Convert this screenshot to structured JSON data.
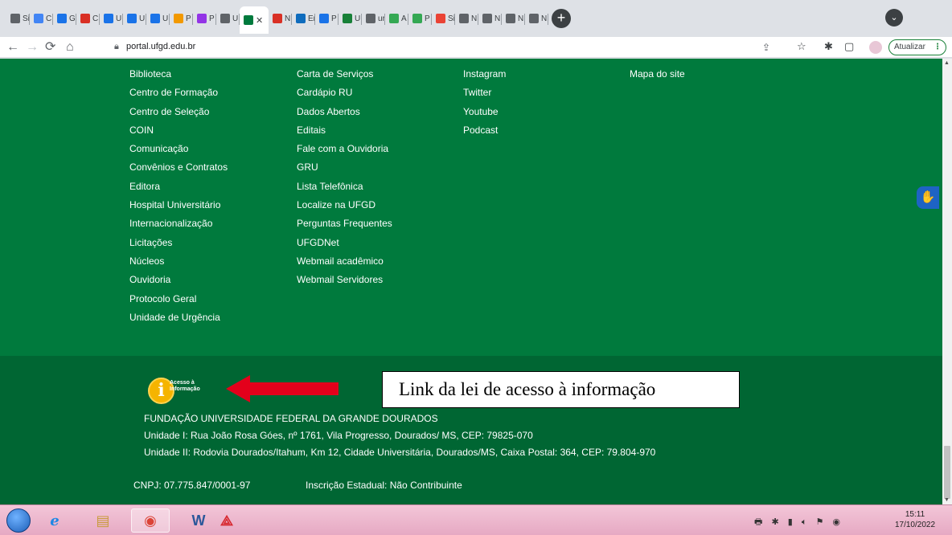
{
  "browser": {
    "tabs": [
      {
        "label": "Si",
        "icon": "chrome-icon",
        "color": "#5f6368"
      },
      {
        "label": "C",
        "icon": "doc-icon",
        "color": "#4285f4"
      },
      {
        "label": "G",
        "icon": "chrome-icon",
        "color": "#1a73e8"
      },
      {
        "label": "C",
        "icon": "gmail-icon",
        "color": "#d93025"
      },
      {
        "label": "U",
        "icon": "doc-icon",
        "color": "#1a73e8"
      },
      {
        "label": "U",
        "icon": "puzzle-icon",
        "color": "#1a73e8"
      },
      {
        "label": "U",
        "icon": "puzzle-icon",
        "color": "#1a73e8"
      },
      {
        "label": "P",
        "icon": "flower-icon",
        "color": "#f29900"
      },
      {
        "label": "P",
        "icon": "circle-icon",
        "color": "#9334e6"
      },
      {
        "label": "U",
        "icon": "book-icon",
        "color": "#5f6368"
      },
      {
        "label": "N",
        "icon": "pdf-icon",
        "color": "#d93025"
      },
      {
        "label": "Er",
        "icon": "outlook-icon",
        "color": "#0f6cbd"
      },
      {
        "label": "P",
        "icon": "chart-icon",
        "color": "#1a73e8"
      },
      {
        "label": "U",
        "icon": "flag-icon",
        "color": "#188038"
      },
      {
        "label": "ur",
        "icon": "chrome-icon",
        "color": "#5f6368"
      },
      {
        "label": "A",
        "icon": "sound-icon",
        "color": "#34a853"
      },
      {
        "label": "P",
        "icon": "sound-icon",
        "color": "#34a853"
      },
      {
        "label": "Si",
        "icon": "s-icon",
        "color": "#ea4335"
      },
      {
        "label": "N",
        "icon": "chrome-icon",
        "color": "#5f6368"
      },
      {
        "label": "N",
        "icon": "chrome-icon",
        "color": "#5f6368"
      },
      {
        "label": "N",
        "icon": "chrome-icon",
        "color": "#5f6368"
      },
      {
        "label": "N",
        "icon": "chrome-icon",
        "color": "#5f6368"
      }
    ],
    "url": "portal.ufgd.edu.br",
    "update_label": "Atualizar"
  },
  "footer_links": {
    "col1": [
      "Biblioteca",
      "Centro de Formação",
      "Centro de Seleção",
      "COIN",
      "Comunicação",
      "Convênios e Contratos",
      "Editora",
      "Hospital Universitário",
      "Internacionalização",
      "Licitações",
      "Núcleos",
      "Ouvidoria",
      "Protocolo Geral",
      "Unidade de Urgência"
    ],
    "col2": [
      "Carta de Serviços",
      "Cardápio RU",
      "Dados Abertos",
      "Editais",
      "Fale com a Ouvidoria",
      "GRU",
      "Lista Telefônica",
      "Localize na UFGD",
      "Perguntas Frequentes",
      "UFGDNet",
      "Webmail acadêmico",
      "Webmail Servidores"
    ],
    "col3": [
      "Instagram",
      "Twitter",
      "Youtube",
      "Podcast"
    ],
    "col4": [
      "Mapa do site"
    ]
  },
  "footer": {
    "logo_text_1": "Acesso à",
    "logo_text_2": "Informação",
    "annotation": "Link da lei de acesso à informação",
    "institution": "FUNDAÇÃO UNIVERSIDADE FEDERAL DA GRANDE DOURADOS",
    "unidade1": "Unidade I: Rua João Rosa Góes, nº 1761, Vila Progresso, Dourados/ MS, CEP: 79825-070",
    "unidade2": "Unidade II: Rodovia Dourados/Itahum, Km 12, Cidade Universitária, Dourados/MS, Caixa Postal: 364, CEP: 79.804-970",
    "cnpj": "CNPJ: 07.775.847/0001-97",
    "inscricao": "Inscrição Estadual: Não Contribuinte"
  },
  "taskbar": {
    "time": "15:11",
    "date": "17/10/2022"
  },
  "colors": {
    "page_green": "#007a3d",
    "footer_green": "#006633",
    "arrow_red": "#e3001b"
  }
}
